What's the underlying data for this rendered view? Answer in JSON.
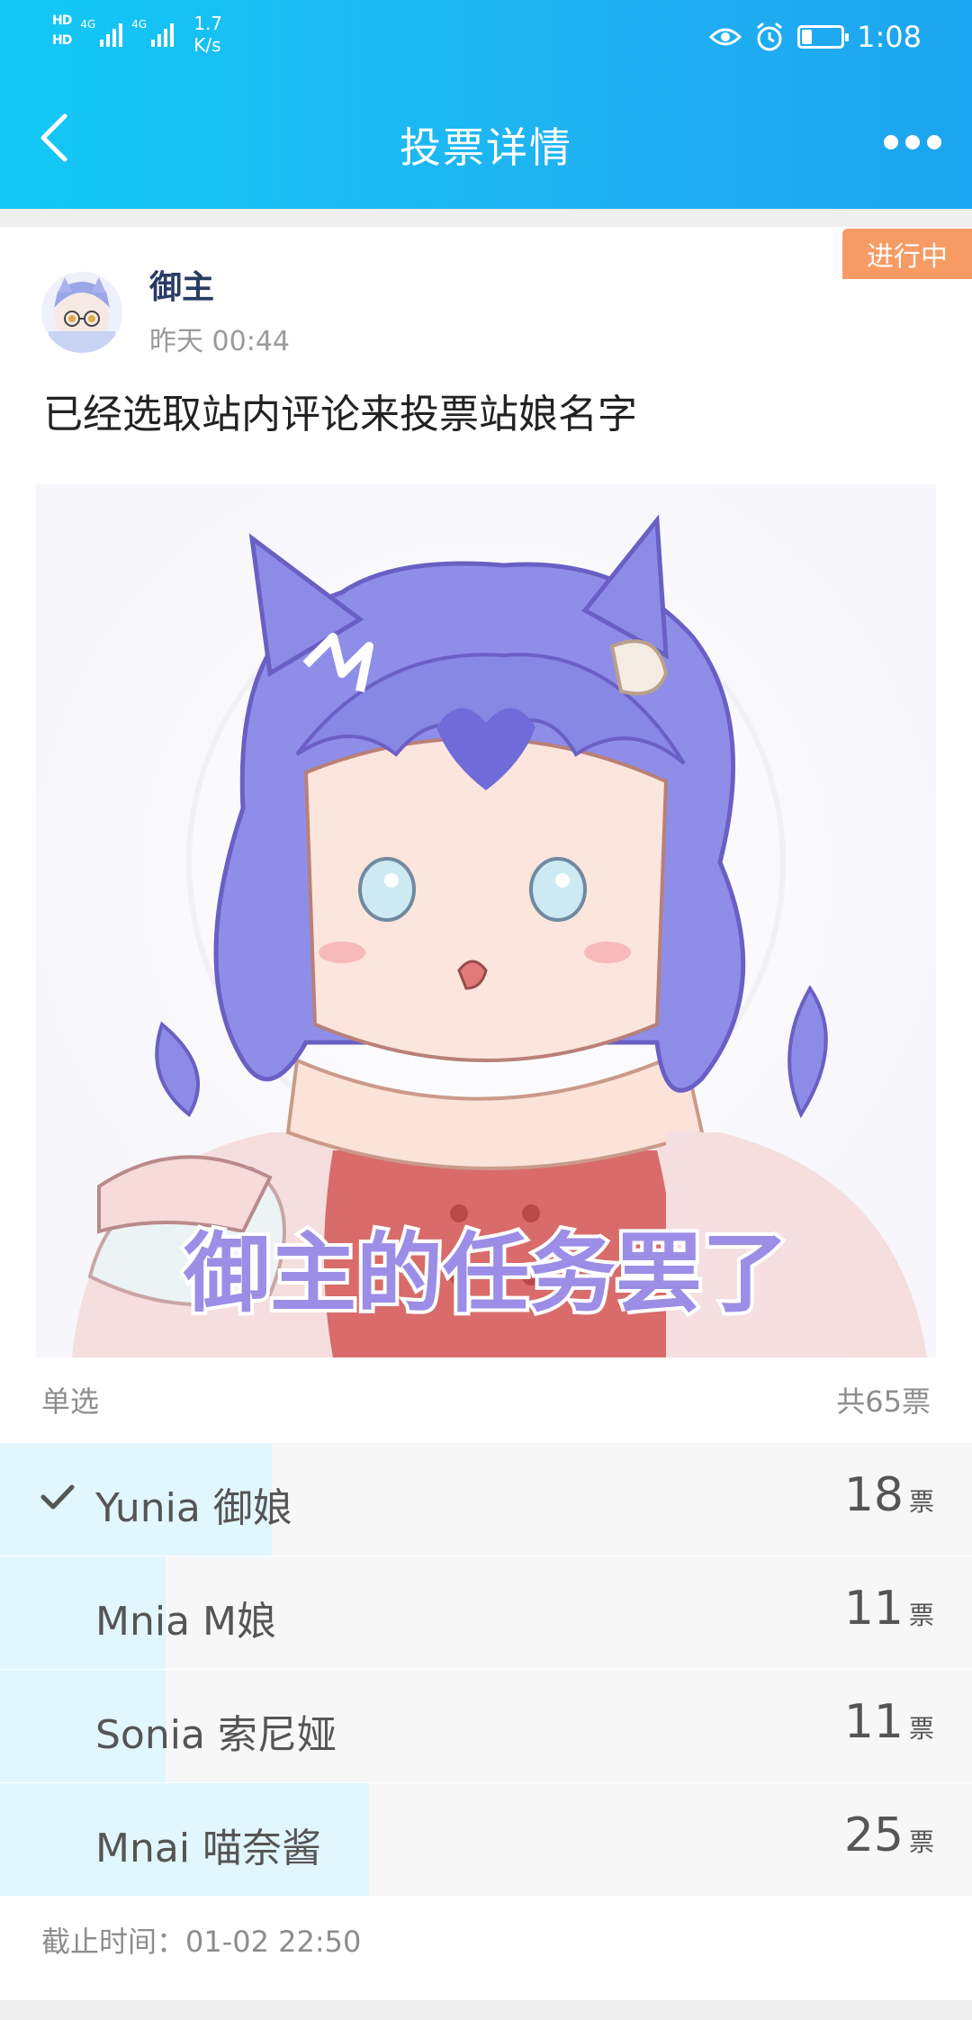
{
  "status_bar": {
    "hd1": "HD",
    "hd2": "HD",
    "network1": "4G",
    "network2": "4G",
    "net_speed": "1.7",
    "net_speed_unit": "K/s",
    "time": "1:08",
    "battery_level": 0.25
  },
  "nav": {
    "title": "投票详情"
  },
  "post": {
    "status_badge": "进行中",
    "author": "御主",
    "time": "昨天 00:44",
    "description": "已经选取站内评论来投票站娘名字",
    "image_caption": "御主的任务罢了"
  },
  "vote": {
    "type": "单选",
    "total": "共65票",
    "vote_unit": "票",
    "options": [
      {
        "label": "Yunia 御娘",
        "votes": "18",
        "selected": true,
        "share": 0.28
      },
      {
        "label": "Mnia M娘",
        "votes": "11",
        "selected": false,
        "share": 0.17
      },
      {
        "label": "Sonia 索尼娅",
        "votes": "11",
        "selected": false,
        "share": 0.17
      },
      {
        "label": "Mnai 喵奈酱",
        "votes": "25",
        "selected": false,
        "share": 0.38
      }
    ],
    "deadline": "截止时间：01-02 22:50"
  },
  "colors": {
    "header_gradient_start": "#12c8f4",
    "header_gradient_end": "#1da4f0",
    "status_badge": "#f79b64",
    "vote_fill": "#e1f6fd",
    "author": "#283b63"
  }
}
